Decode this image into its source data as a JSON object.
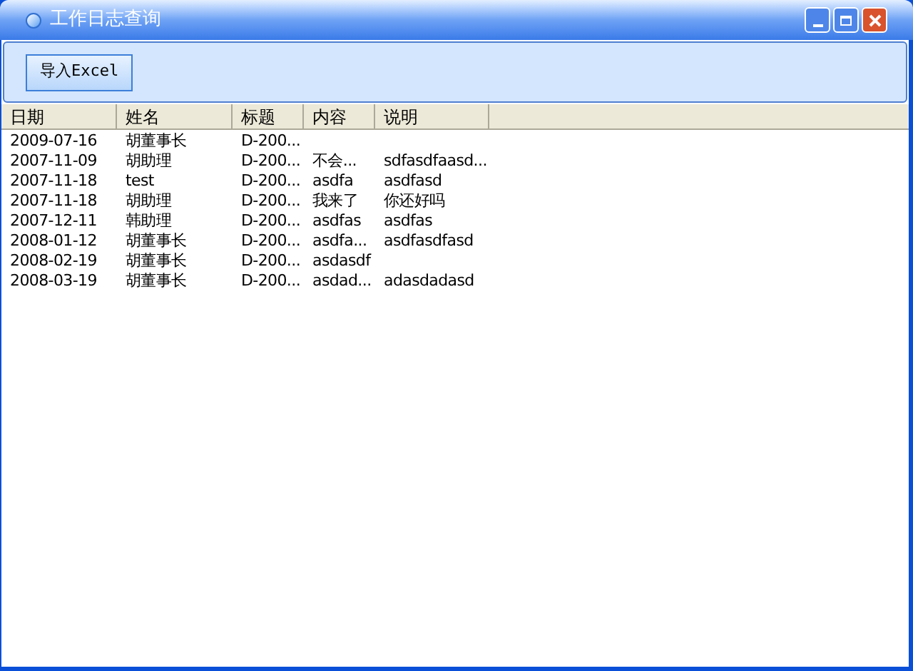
{
  "window": {
    "title": "工作日志查询"
  },
  "toolbar": {
    "buttons": [
      "导入Excel"
    ]
  },
  "table": {
    "columns": [
      "日期",
      "姓名",
      "标题",
      "内容",
      "说明"
    ],
    "rows": [
      [
        "2009-07-16",
        "胡董事长",
        "D-200...",
        "",
        ""
      ],
      [
        "2007-11-09",
        "胡助理",
        "D-200...",
        "不会...",
        "sdfasdfaasd..."
      ],
      [
        "2007-11-18",
        "test",
        "D-200...",
        "asdfa",
        "asdfasd"
      ],
      [
        "2007-11-18",
        "胡助理",
        "D-200...",
        "我来了",
        "你还好吗"
      ],
      [
        "2007-12-11",
        "韩助理",
        "D-200...",
        "asdfas",
        "asdfas"
      ],
      [
        "2008-01-12",
        "胡董事长",
        "D-200...",
        "asdfa...",
        "asdfasdfasd"
      ],
      [
        "2008-02-19",
        "胡董事长",
        "D-200...",
        "asdasdf",
        ""
      ],
      [
        "2008-03-19",
        "胡董事长",
        "D-200...",
        "asdad...",
        "adasdadasd"
      ]
    ]
  }
}
